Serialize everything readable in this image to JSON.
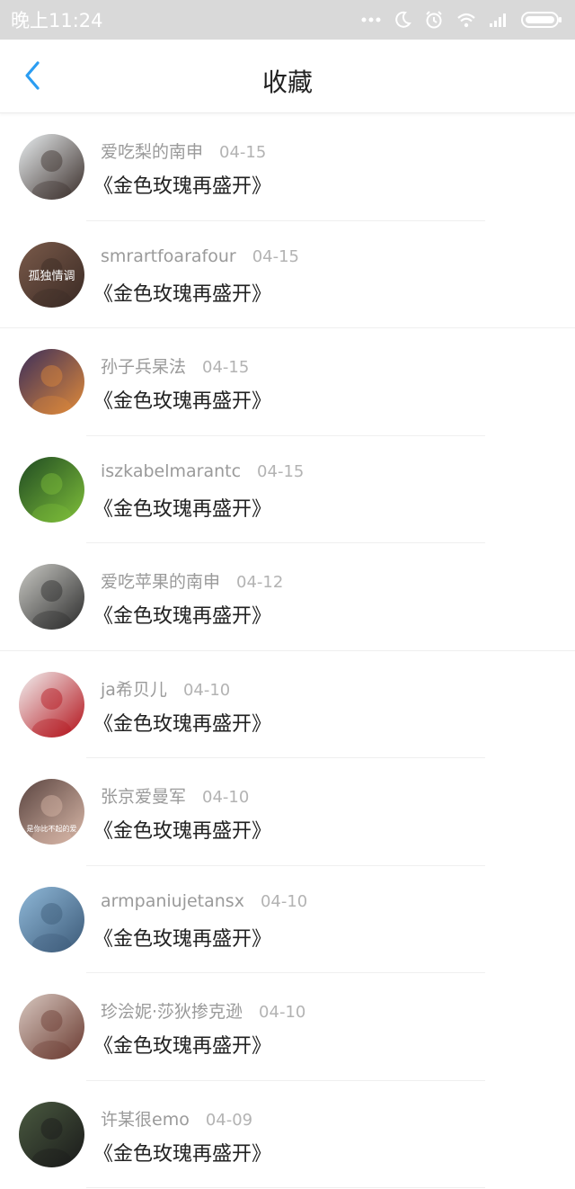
{
  "status": {
    "time": "晚上11:24",
    "icons": [
      "more-icon",
      "moon-icon",
      "alarm-icon",
      "wifi-icon",
      "signal-icon",
      "battery-icon"
    ]
  },
  "header": {
    "title": "收藏",
    "back_icon": "back-chevron-icon",
    "accent": "#2b9df2"
  },
  "favorites": [
    {
      "user": "爱吃梨的南申",
      "date": "04-15",
      "title": "《金色玫瑰再盛开》",
      "avatar_colors": [
        "#e9eef0",
        "#3a2e2a"
      ]
    },
    {
      "user": "smrartfoarafour",
      "date": "04-15",
      "title": "《金色玫瑰再盛开》",
      "avatar_colors": [
        "#7a5a4a",
        "#3a2a24"
      ],
      "avatar_text": "孤独情调"
    },
    {
      "user": "孙子兵杲法",
      "date": "04-15",
      "title": "《金色玫瑰再盛开》",
      "avatar_colors": [
        "#3b2e5a",
        "#e08a3a"
      ]
    },
    {
      "user": "iszkabelmarantc",
      "date": "04-15",
      "title": "《金色玫瑰再盛开》",
      "avatar_colors": [
        "#1f4a22",
        "#7fbf3a"
      ]
    },
    {
      "user": "爱吃苹果的南申",
      "date": "04-12",
      "title": "《金色玫瑰再盛开》",
      "avatar_colors": [
        "#c9c9c4",
        "#2b2b2b"
      ]
    },
    {
      "user": "ja希贝儿",
      "date": "04-10",
      "title": "《金色玫瑰再盛开》",
      "avatar_colors": [
        "#f2f2f2",
        "#b3121a"
      ]
    },
    {
      "user": "张京爱曼军",
      "date": "04-10",
      "title": "《金色玫瑰再盛开》",
      "avatar_colors": [
        "#5a4440",
        "#d9b8a8"
      ],
      "avatar_text": "是你比不起的爱"
    },
    {
      "user": "armpaniujetansx",
      "date": "04-10",
      "title": "《金色玫瑰再盛开》",
      "avatar_colors": [
        "#8fb8d8",
        "#3c5a78"
      ]
    },
    {
      "user": "珍浍妮·莎狄掺克逊",
      "date": "04-10",
      "title": "《金色玫瑰再盛开》",
      "avatar_colors": [
        "#d8c8c0",
        "#6a3a30"
      ]
    },
    {
      "user": "许某很emo",
      "date": "04-09",
      "title": "《金色玫瑰再盛开》",
      "avatar_colors": [
        "#4a5a40",
        "#1a1a1a"
      ]
    }
  ]
}
